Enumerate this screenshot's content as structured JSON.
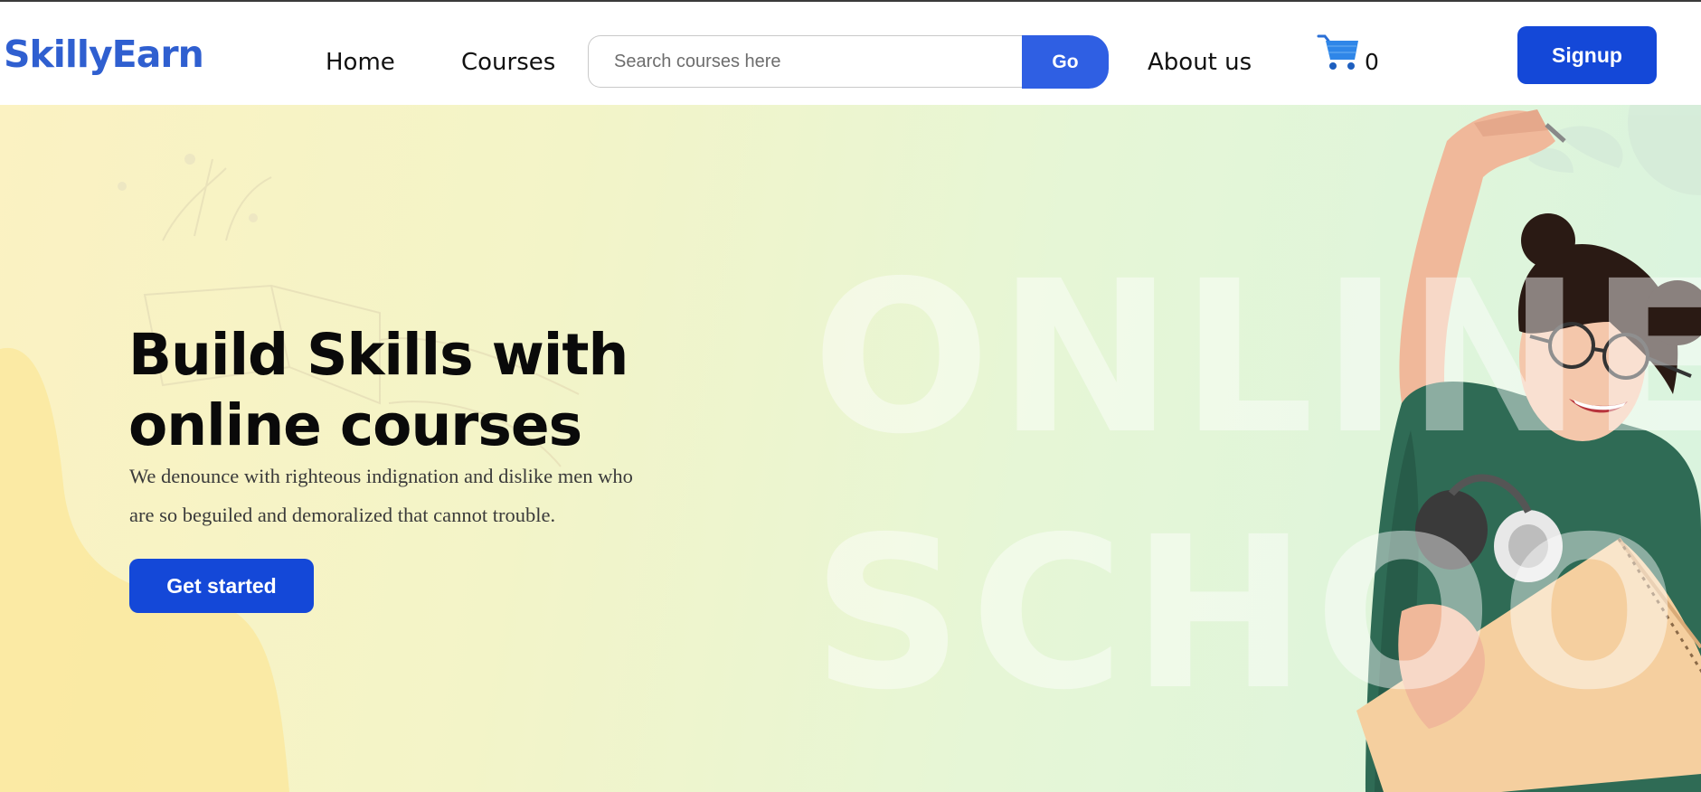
{
  "header": {
    "logo": "SkillyEarn",
    "nav": {
      "home": "Home",
      "courses": "Courses",
      "about": "About us"
    },
    "search": {
      "placeholder": "Search courses here",
      "button": "Go"
    },
    "cart": {
      "icon": "cart-icon",
      "count": "0"
    },
    "signup": "Signup"
  },
  "hero": {
    "title_line1": "Build Skills with",
    "title_line2": "online courses",
    "subtitle": "We denounce with righteous indignation and dislike men who are so beguiled and demoralized that cannot trouble.",
    "cta": "Get started",
    "background_words": [
      "ONLINE",
      "SCHOOL"
    ],
    "image": "student-photo"
  },
  "colors": {
    "brand": "#2f5fd0",
    "button": "#1448d8",
    "go_button": "#2f5fe3",
    "hero_bg_left": "#fbf2c2",
    "hero_bg_right": "#d9f4df"
  }
}
